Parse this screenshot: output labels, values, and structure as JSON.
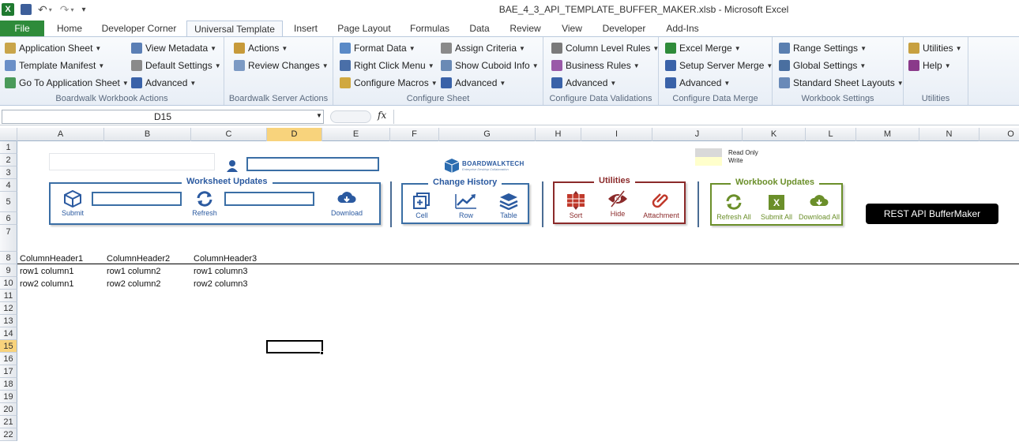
{
  "window": {
    "title": "BAE_4_3_API_TEMPLATE_BUFFER_MAKER.xlsb  -  Microsoft Excel"
  },
  "tabs": [
    "File",
    "Home",
    "Developer Corner",
    "Universal Template",
    "Insert",
    "Page Layout",
    "Formulas",
    "Data",
    "Review",
    "View",
    "Developer",
    "Add-Ins"
  ],
  "active_tab": "Universal Template",
  "ribbon": {
    "workbook_actions": {
      "label": "Boardwalk Workbook Actions",
      "items": [
        "Application Sheet",
        "Template Manifest",
        "Go To Application Sheet",
        "View Metadata",
        "Default Settings",
        "Advanced"
      ]
    },
    "server_actions": {
      "label": "Boardwalk Server Actions",
      "items": [
        "Actions",
        "Review Changes"
      ]
    },
    "configure_sheet": {
      "label": "Configure Sheet",
      "items": [
        "Format Data",
        "Right Click Menu",
        "Configure Macros",
        "Assign Criteria",
        "Show Cuboid Info",
        "Advanced"
      ]
    },
    "data_validations": {
      "label": "Configure Data Validations",
      "items": [
        "Column Level Rules",
        "Business Rules",
        "Advanced"
      ]
    },
    "data_merge": {
      "label": "Configure Data Merge",
      "items": [
        "Excel Merge",
        "Setup Server Merge",
        "Advanced"
      ]
    },
    "workbook_settings": {
      "label": "Workbook Settings",
      "items": [
        "Range Settings",
        "Global Settings",
        "Standard Sheet Layouts"
      ]
    },
    "utilities": {
      "label": "Utilities",
      "items": [
        "Utilities",
        "Help"
      ]
    }
  },
  "formula_bar": {
    "name_box": "D15",
    "fx": "fx",
    "value": ""
  },
  "columns": [
    "A",
    "B",
    "C",
    "D",
    "E",
    "F",
    "G",
    "H",
    "I",
    "J",
    "K",
    "L",
    "M",
    "N",
    "O"
  ],
  "rows": [
    "1",
    "2",
    "3",
    "4",
    "5",
    "6",
    "7",
    "8",
    "9",
    "10",
    "11",
    "12",
    "13",
    "14",
    "15",
    "16",
    "17",
    "18",
    "19",
    "20",
    "21",
    "22"
  ],
  "selected_cell": "D15",
  "sheet": {
    "worksheet_updates": {
      "title": "Worksheet Updates",
      "submit": "Submit",
      "refresh": "Refresh",
      "download": "Download"
    },
    "change_history": {
      "title": "Change History",
      "cell": "Cell",
      "row": "Row",
      "table": "Table"
    },
    "utilities": {
      "title": "Utilities",
      "sort": "Sort",
      "hide": "Hide",
      "attachment": "Attachment"
    },
    "workbook_updates": {
      "title": "Workbook Updates",
      "refresh_all": "Refresh All",
      "submit_all": "Submit All",
      "download_all": "Download All"
    },
    "logo": {
      "name": "BOARDWALKTECH",
      "tagline": "Enterprise Desktop Collaboration"
    },
    "legend": {
      "read_only": "Read Only",
      "write": "Write"
    },
    "rest_button": "REST API BufferMaker",
    "table": {
      "headers": [
        "ColumnHeader1",
        "ColumnHeader2",
        "ColumnHeader3"
      ],
      "rows": [
        [
          "row1 column1",
          "row1 column2",
          "row1 column3"
        ],
        [
          "row2 column1",
          "row2 column2",
          "row2 column3"
        ]
      ]
    }
  },
  "colors": {
    "excel_green": "#2e8b3a",
    "panel_blue": "#3a6ea5",
    "utilities_red": "#8b2a2a",
    "workbook_green": "#6b8f2a",
    "selection_orange": "#f8d37c"
  }
}
